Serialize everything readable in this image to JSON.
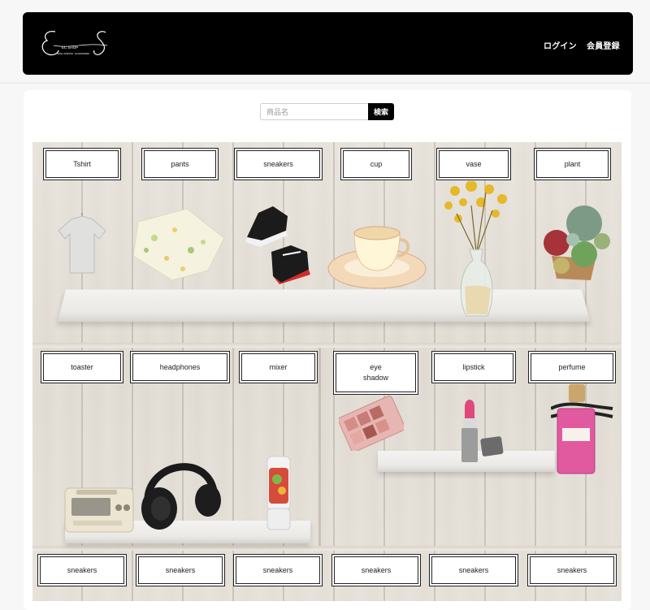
{
  "header": {
    "logo_alt": "EC SHOP",
    "nav": [
      {
        "label": "ログイン"
      },
      {
        "label": "会員登録"
      }
    ]
  },
  "search": {
    "placeholder": "商品名",
    "button_label": "検索"
  },
  "shelves": {
    "top_row": [
      {
        "label": "Tshirt"
      },
      {
        "label": "pants"
      },
      {
        "label": "sneakers"
      },
      {
        "label": "cup"
      },
      {
        "label": "vase"
      },
      {
        "label": "plant"
      }
    ],
    "middle_row": [
      {
        "label": "toaster"
      },
      {
        "label": "headphones"
      },
      {
        "label": "mixer"
      },
      {
        "label": "eye\nshadow"
      },
      {
        "label": "lipstick"
      },
      {
        "label": "perfume"
      }
    ],
    "bottom_row": [
      {
        "label": "sneakers"
      },
      {
        "label": "sneakers"
      },
      {
        "label": "sneakers"
      },
      {
        "label": "sneakers"
      },
      {
        "label": "sneakers"
      },
      {
        "label": "sneakers"
      }
    ]
  },
  "products": [
    "tshirt-image",
    "pants-image",
    "sneakers-image",
    "cup-image",
    "vase-image",
    "plant-image",
    "toaster-image",
    "headphones-image",
    "mixer-image",
    "eyeshadow-image",
    "lipstick-image",
    "perfume-image"
  ]
}
